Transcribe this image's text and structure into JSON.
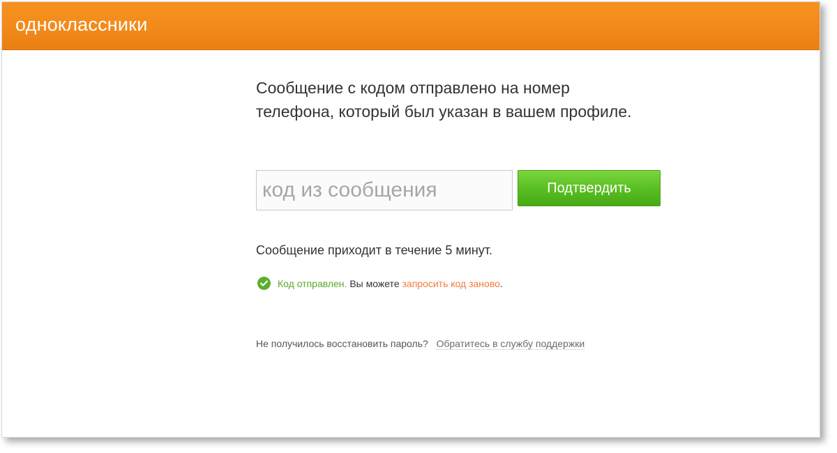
{
  "header": {
    "logo_text": "одноклассники",
    "background_color": "#f28a1b"
  },
  "main": {
    "message": "Сообщение с кодом отправлено на номер телефона, который был указан в вашем профиле.",
    "code_input": {
      "value": "",
      "placeholder": "код из сообщения"
    },
    "confirm_label": "Подтвердить",
    "confirm_color": "#58bd22",
    "delivery_note": "Сообщение приходит в течение 5 минут.",
    "status": {
      "icon": "check-circle-icon",
      "ok_text": "Код отправлен.",
      "middle_text": " Вы можете ",
      "resend_link": "запросить код заново",
      "end_text": "."
    },
    "help": {
      "question": "Не получилось восстановить пароль?",
      "support_link": "Обратитесь в службу поддержки"
    }
  }
}
